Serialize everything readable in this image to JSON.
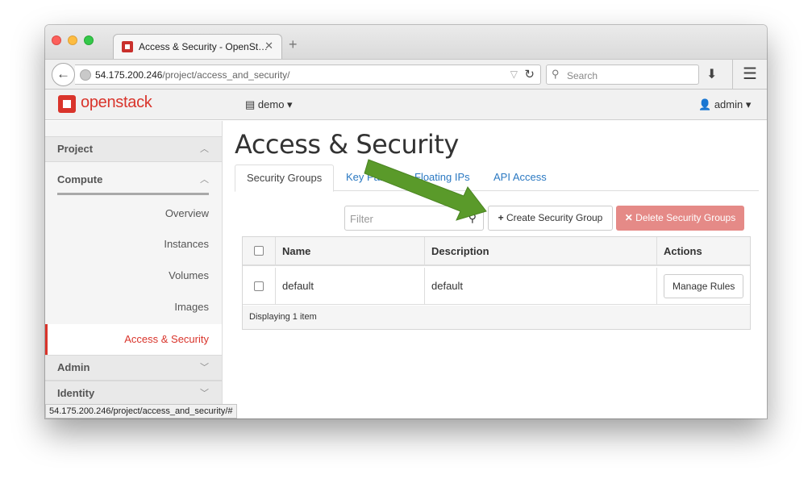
{
  "browser": {
    "tab_title": "Access & Security - OpenSt…",
    "url_host": "54.175.200.246",
    "url_path": "/project/access_and_security/",
    "search_placeholder": "Search",
    "status_url": "54.175.200.246/project/access_and_security/#"
  },
  "topbar": {
    "logo_text": "openstack",
    "project": "demo",
    "user": "admin"
  },
  "sidebar": {
    "project": "Project",
    "compute": "Compute",
    "items": [
      "Overview",
      "Instances",
      "Volumes",
      "Images",
      "Access & Security"
    ],
    "admin": "Admin",
    "identity": "Identity"
  },
  "main": {
    "title": "Access & Security",
    "tabs": [
      "Security Groups",
      "Key Pairs",
      "Floating IPs",
      "API Access"
    ],
    "filter_placeholder": "Filter",
    "create_label": "Create Security Group",
    "delete_label": "Delete Security Groups"
  },
  "table": {
    "headers": [
      "Name",
      "Description",
      "Actions"
    ],
    "rows": [
      {
        "name": "default",
        "description": "default",
        "action": "Manage Rules"
      }
    ],
    "footer": "Displaying 1 item"
  },
  "colors": {
    "brand": "#d9342b",
    "link": "#2b79c2",
    "danger": "#e58a87",
    "annotation_arrow": "#5a9a2a"
  }
}
